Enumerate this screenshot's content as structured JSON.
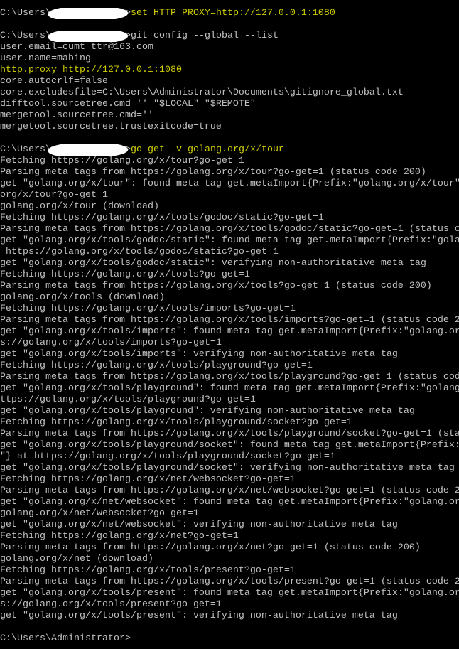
{
  "terminal": {
    "colors": {
      "background": "#000000",
      "text": "#c0c0c0",
      "highlight": "#cccc00",
      "redaction": "#ffffff"
    },
    "prompt_prefix": "C:\\Users\\",
    "prompt_suffix": ">",
    "final_prompt": "C:\\Users\\Administrator>",
    "lines": [
      {
        "prompt": true,
        "cmd": "set HTTP_PROXY=http://127.0.0.1:1080",
        "color": "yellow"
      },
      {
        "text": ""
      },
      {
        "prompt": true,
        "cmd": "git config --global --list"
      },
      {
        "text": "user.email=cumt_ttr@163.com"
      },
      {
        "text": "user.name=mabing"
      },
      {
        "text": "http.proxy=http://127.0.0.1:1080",
        "color": "yellow"
      },
      {
        "text": "core.autocrlf=false"
      },
      {
        "text": "core.excludesfile=C:\\Users\\Administrator\\Documents\\gitignore_global.txt"
      },
      {
        "text": "difftool.sourcetree.cmd='' \"$LOCAL\" \"$REMOTE\""
      },
      {
        "text": "mergetool.sourcetree.cmd=''"
      },
      {
        "text": "mergetool.sourcetree.trustexitcode=true"
      },
      {
        "text": ""
      },
      {
        "prompt": true,
        "cmd": "go get -v golang.org/x/tour",
        "color": "yellow"
      },
      {
        "text": "Fetching https://golang.org/x/tour?go-get=1"
      },
      {
        "text": "Parsing meta tags from https://golang.org/x/tour?go-get=1 (status code 200)"
      },
      {
        "text": "get \"golang.org/x/tour\": found meta tag get.metaImport{Prefix:\"golang.org/x/tour\""
      },
      {
        "text": "org/x/tour?go-get=1"
      },
      {
        "text": "golang.org/x/tour (download)"
      },
      {
        "text": "Fetching https://golang.org/x/tools/godoc/static?go-get=1"
      },
      {
        "text": "Parsing meta tags from https://golang.org/x/tools/godoc/static?go-get=1 (status c"
      },
      {
        "text": "get \"golang.org/x/tools/godoc/static\": found meta tag get.metaImport{Prefix:\"gola"
      },
      {
        "text": " https://golang.org/x/tools/godoc/static?go-get=1"
      },
      {
        "text": "get \"golang.org/x/tools/godoc/static\": verifying non-authoritative meta tag"
      },
      {
        "text": "Fetching https://golang.org/x/tools?go-get=1"
      },
      {
        "text": "Parsing meta tags from https://golang.org/x/tools?go-get=1 (status code 200)"
      },
      {
        "text": "golang.org/x/tools (download)"
      },
      {
        "text": "Fetching https://golang.org/x/tools/imports?go-get=1"
      },
      {
        "text": "Parsing meta tags from https://golang.org/x/tools/imports?go-get=1 (status code 2"
      },
      {
        "text": "get \"golang.org/x/tools/imports\": found meta tag get.metaImport{Prefix:\"golang.or"
      },
      {
        "text": "s://golang.org/x/tools/imports?go-get=1"
      },
      {
        "text": "get \"golang.org/x/tools/imports\": verifying non-authoritative meta tag"
      },
      {
        "text": "Fetching https://golang.org/x/tools/playground?go-get=1"
      },
      {
        "text": "Parsing meta tags from https://golang.org/x/tools/playground?go-get=1 (status cod"
      },
      {
        "text": "get \"golang.org/x/tools/playground\": found meta tag get.metaImport{Prefix:\"golang"
      },
      {
        "text": "ttps://golang.org/x/tools/playground?go-get=1"
      },
      {
        "text": "get \"golang.org/x/tools/playground\": verifying non-authoritative meta tag"
      },
      {
        "text": "Fetching https://golang.org/x/tools/playground/socket?go-get=1"
      },
      {
        "text": "Parsing meta tags from https://golang.org/x/tools/playground/socket?go-get=1 (sta"
      },
      {
        "text": "get \"golang.org/x/tools/playground/socket\": found meta tag get.metaImport{Prefix:"
      },
      {
        "text": "\"} at https://golang.org/x/tools/playground/socket?go-get=1"
      },
      {
        "text": "get \"golang.org/x/tools/playground/socket\": verifying non-authoritative meta tag"
      },
      {
        "text": "Fetching https://golang.org/x/net/websocket?go-get=1"
      },
      {
        "text": "Parsing meta tags from https://golang.org/x/net/websocket?go-get=1 (status code 2"
      },
      {
        "text": "get \"golang.org/x/net/websocket\": found meta tag get.metaImport{Prefix:\"golang.or"
      },
      {
        "text": "golang.org/x/net/websocket?go-get=1"
      },
      {
        "text": "get \"golang.org/x/net/websocket\": verifying non-authoritative meta tag"
      },
      {
        "text": "Fetching https://golang.org/x/net?go-get=1"
      },
      {
        "text": "Parsing meta tags from https://golang.org/x/net?go-get=1 (status code 200)"
      },
      {
        "text": "golang.org/x/net (download)"
      },
      {
        "text": "Fetching https://golang.org/x/tools/present?go-get=1"
      },
      {
        "text": "Parsing meta tags from https://golang.org/x/tools/present?go-get=1 (status code 2"
      },
      {
        "text": "get \"golang.org/x/tools/present\": found meta tag get.metaImport{Prefix:\"golang.or"
      },
      {
        "text": "s://golang.org/x/tools/present?go-get=1"
      },
      {
        "text": "get \"golang.org/x/tools/present\": verifying non-authoritative meta tag"
      },
      {
        "text": ""
      }
    ]
  }
}
